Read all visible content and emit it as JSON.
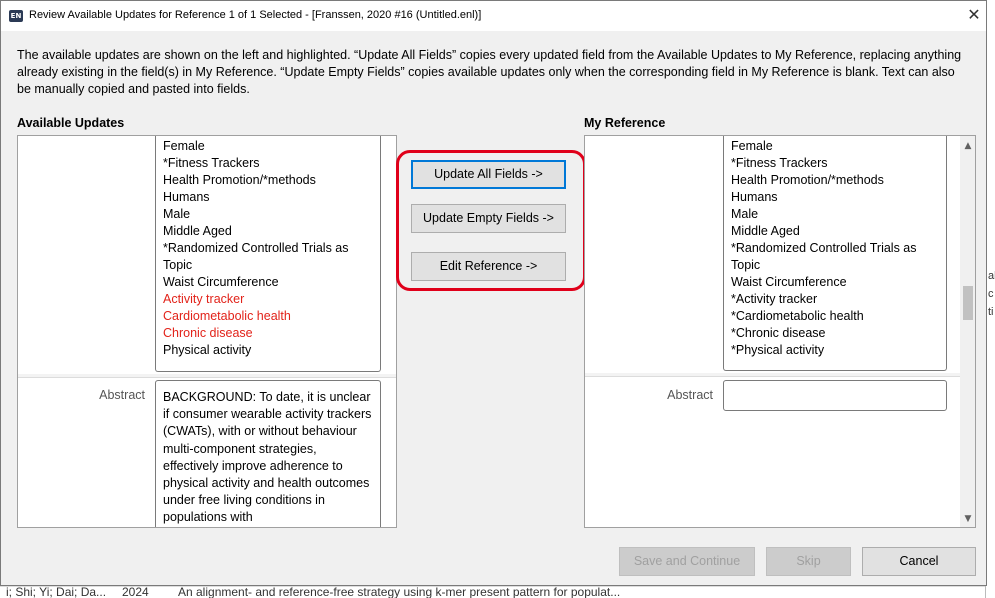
{
  "window": {
    "icon_text": "EN",
    "title": "Review Available Updates for Reference 1 of 1 Selected - [Franssen, 2020 #16 (Untitled.enl)]",
    "close_glyph": "✕"
  },
  "instructions": "The available updates are shown on the left and highlighted. “Update All Fields” copies every updated field from the Available Updates to My Reference, replacing anything already existing in the field(s) in My Reference. “Update Empty Fields” copies available updates only when the corresponding field in My Reference is blank. Text can also be manually copied and pasted into fields.",
  "available_updates": {
    "heading": "Available Updates",
    "keywords": [
      {
        "text": "Female",
        "updated": false
      },
      {
        "text": "*Fitness Trackers",
        "updated": false
      },
      {
        "text": "Health Promotion/*methods",
        "updated": false
      },
      {
        "text": "Humans",
        "updated": false
      },
      {
        "text": "Male",
        "updated": false
      },
      {
        "text": "Middle Aged",
        "updated": false
      },
      {
        "text": "*Randomized Controlled Trials as",
        "updated": false
      },
      {
        "text": "Topic",
        "updated": false
      },
      {
        "text": "Waist Circumference",
        "updated": false
      },
      {
        "text": "Activity tracker",
        "updated": true
      },
      {
        "text": "Cardiometabolic health",
        "updated": true
      },
      {
        "text": "Chronic disease",
        "updated": true
      },
      {
        "text": "Physical activity",
        "updated": false
      }
    ],
    "abstract_label": "Abstract",
    "abstract_text": "BACKGROUND: To date, it is unclear if consumer wearable activity trackers (CWATs), with or without behaviour multi-component strategies, effectively improve adherence to physical activity and health outcomes under free living conditions in populations with"
  },
  "actions": {
    "update_all": "Update All Fields ->",
    "update_empty": "Update Empty Fields ->",
    "edit_reference": "Edit Reference ->"
  },
  "my_reference": {
    "heading": "My Reference",
    "keywords": [
      "Female",
      "*Fitness Trackers",
      "Health Promotion/*methods",
      "Humans",
      "Male",
      "Middle Aged",
      "*Randomized Controlled Trials as",
      "Topic",
      "Waist Circumference",
      "*Activity tracker",
      "*Cardiometabolic health",
      "*Chronic disease",
      "*Physical activity"
    ],
    "abstract_label": "Abstract",
    "abstract_value": ""
  },
  "footer": {
    "save_and_continue": "Save and Continue",
    "skip": "Skip",
    "cancel": "Cancel"
  },
  "background_app": {
    "row_author": "i; Shi; Yi; Dai; Da...",
    "row_year": "2024",
    "row_title": "An alignment- and reference-free strategy using k-mer present pattern for populat...",
    "right_edge_chars": [
      "al",
      "c",
      "ti"
    ]
  },
  "colors": {
    "updated_text": "#e2231a",
    "highlight_ring": "#e0001a",
    "primary_focus": "#0078d7"
  }
}
